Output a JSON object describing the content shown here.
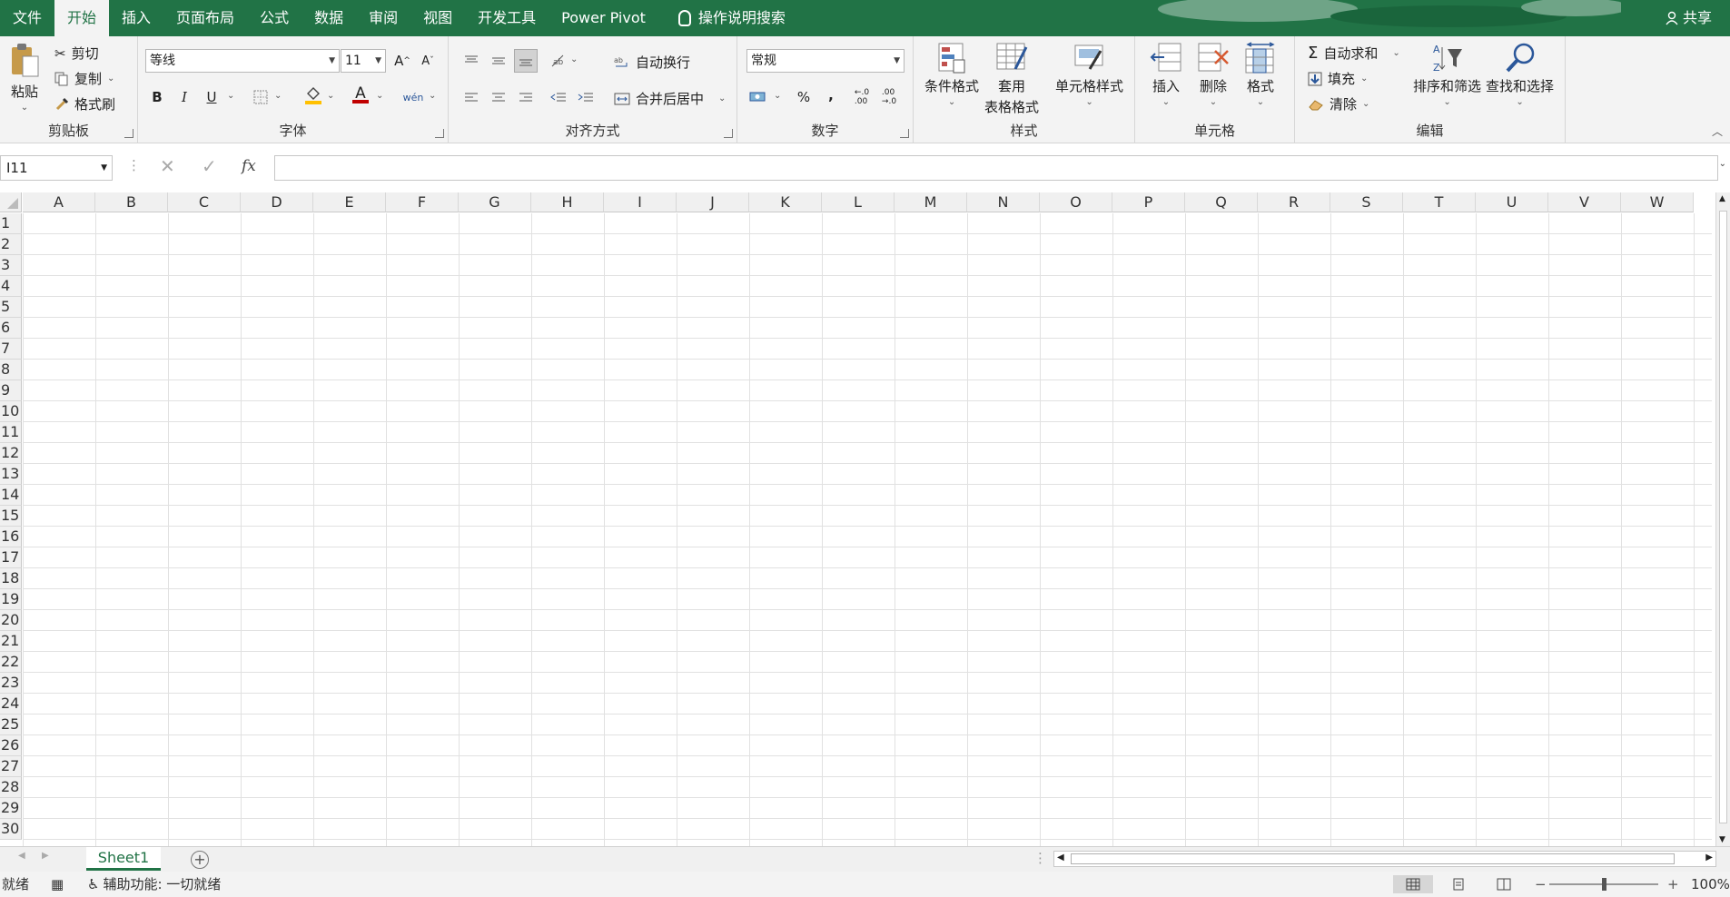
{
  "tabs": [
    "文件",
    "开始",
    "插入",
    "页面布局",
    "公式",
    "数据",
    "审阅",
    "视图",
    "开发工具",
    "Power Pivot"
  ],
  "active_tab_index": 1,
  "tell_me": "操作说明搜索",
  "share": "共享",
  "ribbon": {
    "clipboard": {
      "label": "剪贴板",
      "paste": "粘贴",
      "cut": "剪切",
      "copy": "复制",
      "format_painter": "格式刷"
    },
    "font": {
      "label": "字体",
      "font_name": "等线",
      "font_size": "11",
      "bold": "B",
      "italic": "I",
      "underline": "U",
      "grow": "A",
      "shrink": "A",
      "font_color_letter": "A",
      "phonetic": "wén"
    },
    "alignment": {
      "label": "对齐方式",
      "wrap": "自动换行",
      "merge": "合并后居中"
    },
    "number": {
      "label": "数字",
      "format": "常规",
      "percent": "%",
      "comma": ","
    },
    "styles": {
      "label": "样式",
      "conditional": "条件格式",
      "table_fmt_1": "套用",
      "table_fmt_2": "表格格式",
      "cell_styles": "单元格样式"
    },
    "cells": {
      "label": "单元格",
      "insert": "插入",
      "delete": "删除",
      "format": "格式"
    },
    "editing": {
      "label": "编辑",
      "autosum": "自动求和",
      "fill": "填充",
      "clear": "清除",
      "sort_filter": "排序和筛选",
      "find_select": "查找和选择"
    }
  },
  "formula_bar": {
    "name_box": "I11",
    "fx": "fx",
    "value": ""
  },
  "columns": [
    "A",
    "B",
    "C",
    "D",
    "E",
    "F",
    "G",
    "H",
    "I",
    "J",
    "K",
    "L",
    "M",
    "N",
    "O",
    "P",
    "Q",
    "R",
    "S",
    "T",
    "U",
    "V",
    "W"
  ],
  "rows": [
    "1",
    "2",
    "3",
    "4",
    "5",
    "6",
    "7",
    "8",
    "9",
    "10",
    "11",
    "12",
    "13",
    "14",
    "15",
    "16",
    "17",
    "18",
    "19",
    "20",
    "21",
    "22",
    "23",
    "24",
    "25",
    "26",
    "27",
    "28",
    "29",
    "30"
  ],
  "sheets": [
    "Sheet1"
  ],
  "status": {
    "ready": "就绪",
    "accessibility": "辅助功能: 一切就绪",
    "zoom": "100%"
  },
  "colors": {
    "accent": "#217346"
  }
}
